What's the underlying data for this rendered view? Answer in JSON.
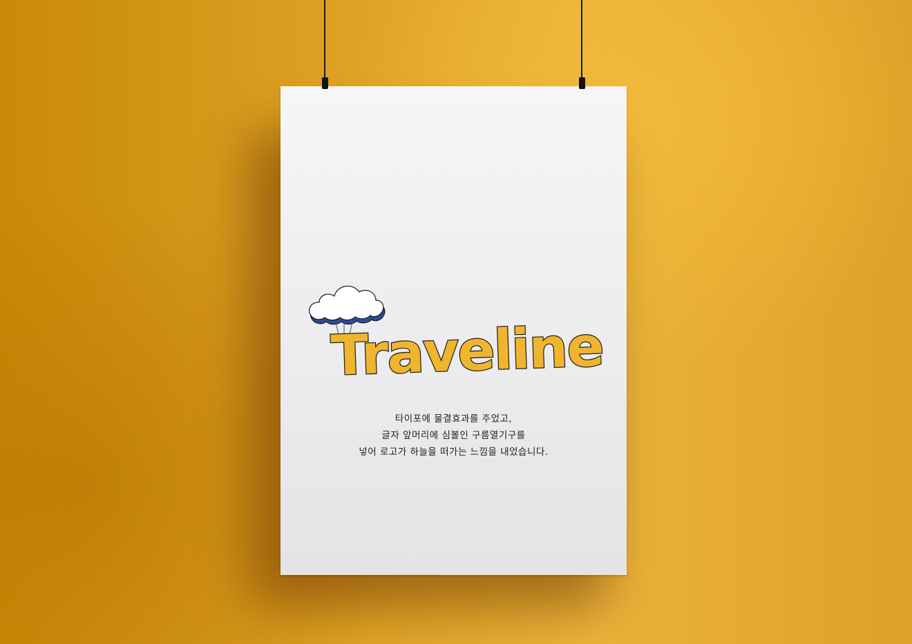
{
  "poster": {
    "logo_text": "Traveline",
    "description_lines": [
      "타이포에 물결효과를 주었고,",
      "글자 앞머리에 심볼인 구름열기구를",
      "넣어 로고가 하늘을 떠가는 느낌을 내었습니다."
    ]
  },
  "colors": {
    "wall": "#e0a323",
    "poster": "#f1f1f2",
    "logo_fill": "#f0b52f",
    "cloud_shadow": "#2e4a9e",
    "text": "#1d1d1d"
  },
  "icons": {
    "symbol": "cloud-hot-air-balloon-icon"
  }
}
